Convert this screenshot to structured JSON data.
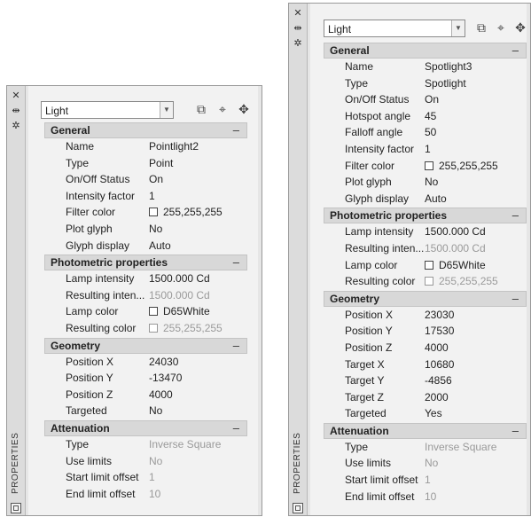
{
  "strip": {
    "close": "✕",
    "autohide": "⇹",
    "options": "✲",
    "title": "PROPERTIES"
  },
  "left_panel": {
    "selector": "Light",
    "general": {
      "title": "General",
      "toggle": "–",
      "rows": [
        [
          "Name",
          "Pointlight2"
        ],
        [
          "Type",
          "Point"
        ],
        [
          "On/Off Status",
          "On"
        ],
        [
          "Intensity factor",
          "1"
        ],
        [
          "Filter color",
          "255,255,255"
        ],
        [
          "Plot glyph",
          "No"
        ],
        [
          "Glyph display",
          "Auto"
        ]
      ]
    },
    "photometric": {
      "title": "Photometric properties",
      "toggle": "–",
      "rows": [
        [
          "Lamp intensity",
          "1500.000 Cd"
        ],
        [
          "Resulting inten...",
          "1500.000 Cd"
        ],
        [
          "Lamp color",
          "D65White"
        ],
        [
          "Resulting color",
          "255,255,255"
        ]
      ]
    },
    "geometry": {
      "title": "Geometry",
      "toggle": "–",
      "rows": [
        [
          "Position X",
          "24030"
        ],
        [
          "Position Y",
          "-13470"
        ],
        [
          "Position Z",
          "4000"
        ],
        [
          "Targeted",
          "No"
        ]
      ]
    },
    "attenuation": {
      "title": "Attenuation",
      "toggle": "–",
      "rows": [
        [
          "Type",
          "Inverse Square"
        ],
        [
          "Use limits",
          "No"
        ],
        [
          "Start limit offset",
          "1"
        ],
        [
          "End limit offset",
          "10"
        ]
      ]
    }
  },
  "right_panel": {
    "selector": "Light",
    "general": {
      "title": "General",
      "toggle": "–",
      "rows": [
        [
          "Name",
          "Spotlight3"
        ],
        [
          "Type",
          "Spotlight"
        ],
        [
          "On/Off Status",
          "On"
        ],
        [
          "Hotspot angle",
          "45"
        ],
        [
          "Falloff angle",
          "50"
        ],
        [
          "Intensity factor",
          "1"
        ],
        [
          "Filter color",
          "255,255,255"
        ],
        [
          "Plot glyph",
          "No"
        ],
        [
          "Glyph display",
          "Auto"
        ]
      ]
    },
    "photometric": {
      "title": "Photometric properties",
      "toggle": "–",
      "rows": [
        [
          "Lamp intensity",
          "1500.000 Cd"
        ],
        [
          "Resulting inten...",
          "1500.000 Cd"
        ],
        [
          "Lamp color",
          "D65White"
        ],
        [
          "Resulting color",
          "255,255,255"
        ]
      ]
    },
    "geometry": {
      "title": "Geometry",
      "toggle": "–",
      "rows": [
        [
          "Position X",
          "23030"
        ],
        [
          "Position Y",
          "17530"
        ],
        [
          "Position Z",
          "4000"
        ],
        [
          "Target X",
          "10680"
        ],
        [
          "Target Y",
          "-4856"
        ],
        [
          "Target Z",
          "2000"
        ],
        [
          "Targeted",
          "Yes"
        ]
      ]
    },
    "attenuation": {
      "title": "Attenuation",
      "toggle": "–",
      "rows": [
        [
          "Type",
          "Inverse Square"
        ],
        [
          "Use limits",
          "No"
        ],
        [
          "Start limit offset",
          "1"
        ],
        [
          "End limit offset",
          "10"
        ]
      ]
    }
  },
  "colors": {
    "panel_bg": "#e6e6e6",
    "section_bg": "#d8d8d8",
    "disabled_text": "#9a9a9a"
  },
  "icons": [
    "close-icon",
    "autohide-icon",
    "options-icon",
    "quick-select-icon",
    "select-objects-icon",
    "toggle-pickadd-icon",
    "properties-palette-icon"
  ]
}
